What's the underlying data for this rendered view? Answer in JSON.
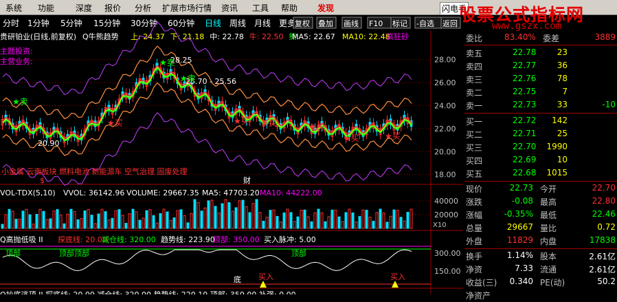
{
  "menu": [
    "系统",
    "功能",
    "深度",
    "报价",
    "分析",
    "扩展市场行情",
    "资讯",
    "工具",
    "帮助",
    "发现"
  ],
  "window": {
    "stock_btn": "闪电手"
  },
  "watermark": {
    "title": "股票公式指标网",
    "url": "www.gszx.com"
  },
  "periods": [
    "分时",
    "1分钟",
    "5分钟",
    "15分钟",
    "30分钟",
    "60分钟",
    "日线",
    "周线",
    "月线",
    "更多"
  ],
  "period_active": "日线",
  "toolbar": [
    "复权",
    "叠加",
    "画线",
    "F10",
    "标记",
    "-自选",
    "返回"
  ],
  "main": {
    "title": "贵研铂业(日线,前复权)",
    "indicator": "Q牛熊趋势",
    "legend": [
      {
        "label": "上: 24.37",
        "color": "#ffff00"
      },
      {
        "label": "下: 21.18",
        "color": "#ffff00"
      },
      {
        "label": "中: 22.78",
        "color": "#ffffff"
      },
      {
        "label": "牛: 22.50",
        "color": "#ff3030"
      },
      {
        "label": "熊:",
        "color": "#00ff00"
      }
    ],
    "ma5": "MA5: 22.67",
    "ma10": "MA10: 22.48",
    "crazy": "疯狂砂",
    "labels": {
      "main_tip1": "主题投资:",
      "main_tip2": "主营业务:",
      "sector": "小金属 云南板块 燃料电池 新能源车 空气治理 固废处理",
      "cai": "财",
      "dollar": "$"
    },
    "price_high": "28.25",
    "price_low": "20.90",
    "range": "25.70 - 25.56",
    "star_sell": "卖",
    "star_buy": "买",
    "y_ticks": [
      "28.00",
      "26.00",
      "24.00",
      "22.00",
      "20.00",
      "18.00"
    ]
  },
  "volume": {
    "title": "VOL-TDX(5,10)",
    "vvol": "VVOL: 36142.96",
    "volume": "VOLUME: 29667.35",
    "ma5": "MA5: 47703.20",
    "ma10": "MA10: 44222.00",
    "y_ticks": [
      "40000",
      "20000"
    ],
    "unit": "X10"
  },
  "osc": {
    "title": "Q高抛低吸 II",
    "tanbi": "探底线: 20.00",
    "jiancang": "减仓线: 320.00",
    "trend": "趋势线: 223.90",
    "top": "顶部: 350.00",
    "buy": "买入脉冲: 5.00",
    "y_ticks": [
      "300.00",
      "150.00"
    ],
    "di": "底",
    "maru": "买入",
    "top_tags": [
      "顶部",
      "顶部顶部",
      "顶部"
    ]
  },
  "osc2": {
    "title": "Q抄底逃顶 II",
    "text": "探底线: 20.00    减仓线: 320.00    趋势线: 220.10    顶部: 350.00    补强: 0.00"
  },
  "quote": {
    "header": [
      "委比",
      "83.40%",
      "委差",
      "3889"
    ],
    "asks": [
      [
        "卖五",
        "22.78",
        "23",
        ""
      ],
      [
        "卖四",
        "22.77",
        "36",
        ""
      ],
      [
        "卖三",
        "22.76",
        "78",
        ""
      ],
      [
        "卖二",
        "22.75",
        "7",
        ""
      ],
      [
        "卖一",
        "22.73",
        "33",
        "-10"
      ]
    ],
    "bids": [
      [
        "买一",
        "22.72",
        "142",
        ""
      ],
      [
        "买二",
        "22.71",
        "25",
        ""
      ],
      [
        "买三",
        "22.70",
        "1990",
        ""
      ],
      [
        "买四",
        "22.69",
        "10",
        ""
      ],
      [
        "买五",
        "22.68",
        "1015",
        ""
      ]
    ],
    "stats": [
      [
        "现价",
        "22.73",
        "今开",
        "22.70"
      ],
      [
        "涨跌",
        "-0.08",
        "最高",
        "22.80"
      ],
      [
        "涨幅",
        "-0.35%",
        "最低",
        "22.46"
      ],
      [
        "总量",
        "29667",
        "量比",
        "0.72"
      ],
      [
        "外盘",
        "11829",
        "内盘",
        "17838"
      ]
    ],
    "fund": [
      [
        "换手",
        "1.14%",
        "股本",
        "2.61亿"
      ],
      [
        "净资",
        "7.33",
        "流通",
        "2.61亿"
      ],
      [
        "收益(三)",
        "0.340",
        "PE(动)",
        "50.2"
      ]
    ],
    "footer": "净资产"
  },
  "colors": {
    "up": "#ff3030",
    "down": "#00ff00",
    "bg": "#000000",
    "grid": "#a00000",
    "accent": "#ffff00"
  }
}
